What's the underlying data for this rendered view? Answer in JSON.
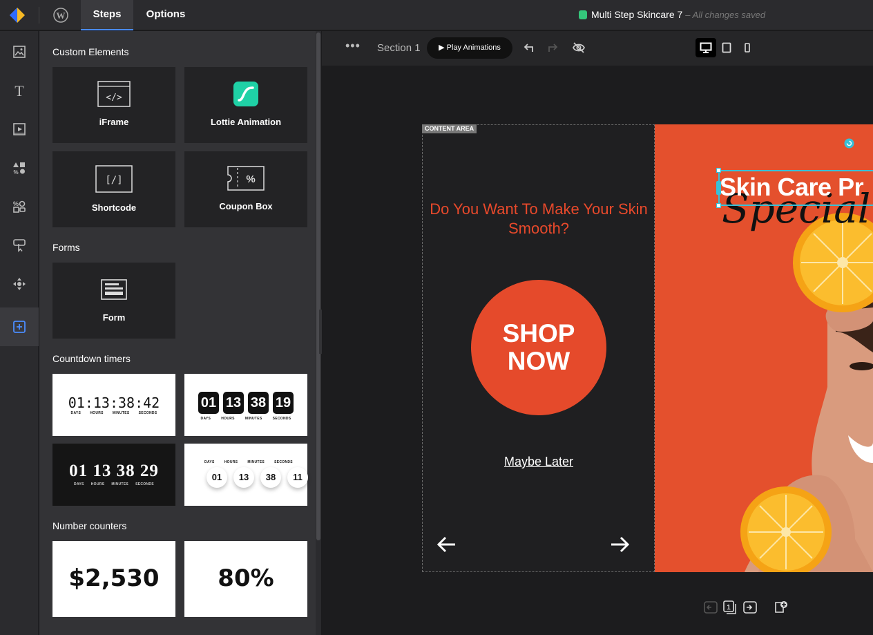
{
  "topbar": {
    "tabs": [
      {
        "label": "Steps"
      },
      {
        "label": "Options"
      }
    ],
    "doc_title": "Multi Step Skincare 7",
    "doc_status": "– All changes saved"
  },
  "panel": {
    "sections": {
      "custom": "Custom Elements",
      "forms": "Forms",
      "countdown": "Countdown timers",
      "counters": "Number counters"
    },
    "tiles": {
      "iframe": "iFrame",
      "lottie": "Lottie Animation",
      "shortcode": "Shortcode",
      "coupon": "Coupon Box",
      "form": "Form"
    },
    "countdown": {
      "labels": [
        "DAYS",
        "HOURS",
        "MINUTES",
        "SECONDS"
      ],
      "t1": "01:13:38:42",
      "t2": [
        "01",
        "13",
        "38",
        "19"
      ],
      "t3": "01 13 38 29",
      "t4": [
        "01",
        "13",
        "38",
        "11"
      ]
    },
    "counters": {
      "money": "$2,530",
      "percent": "80%"
    }
  },
  "canvas_toolbar": {
    "section_label": "Section 1",
    "play_label": "▶ Play Animations"
  },
  "canvas": {
    "content_area_badge": "CONTENT AREA",
    "headline": "Do You Want To Make Your Skin Smooth?",
    "shop_line1": "SHOP",
    "shop_line2": "NOW",
    "maybe_later": "Maybe Later",
    "hero_title": "Skin Care Pr",
    "hero_script": "Special O"
  },
  "colors": {
    "accent": "#4b8dff",
    "brand_orange": "#e54a2b",
    "selection": "#38c0d8"
  }
}
